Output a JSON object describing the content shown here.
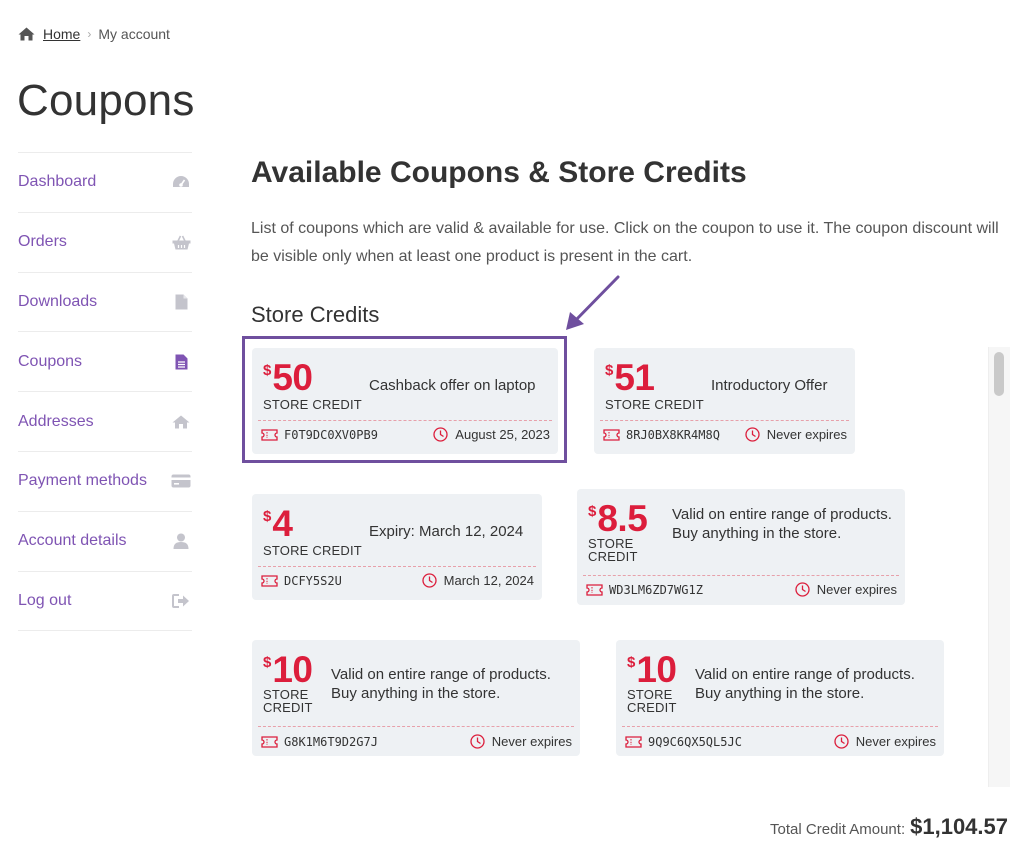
{
  "breadcrumb": {
    "home": "Home",
    "separator": "›",
    "current": "My account"
  },
  "page_title": "Coupons",
  "sidebar": {
    "items": [
      {
        "label": "Dashboard",
        "icon": "dashboard-gauge-icon"
      },
      {
        "label": "Orders",
        "icon": "basket-icon"
      },
      {
        "label": "Downloads",
        "icon": "file-icon"
      },
      {
        "label": "Coupons",
        "icon": "document-icon",
        "active": true
      },
      {
        "label": "Addresses",
        "icon": "home-icon"
      },
      {
        "label": "Payment methods",
        "icon": "credit-card-icon"
      },
      {
        "label": "Account details",
        "icon": "user-icon"
      },
      {
        "label": "Log out",
        "icon": "sign-out-icon"
      }
    ]
  },
  "main": {
    "heading": "Available Coupons & Store Credits",
    "intro": "List of coupons which are valid & available for use. Click on the coupon to use it. The coupon discount will be visible only when at least one product is present in the cart.",
    "section_title": "Store Credits"
  },
  "coupons": [
    {
      "currency": "$",
      "amount": "50",
      "type": "STORE CREDIT",
      "description": "Cashback offer on laptop",
      "code": "F0T9DC0XV0PB9",
      "expiry": "August 25, 2023"
    },
    {
      "currency": "$",
      "amount": "51",
      "type": "STORE CREDIT",
      "description": "Introductory Offer",
      "code": "8RJ0BX8KR4M8Q",
      "expiry": "Never expires"
    },
    {
      "currency": "$",
      "amount": "4",
      "type": "STORE CREDIT",
      "description": "Expiry: March 12, 2024",
      "code": "DCFY5S2U",
      "expiry": "March 12, 2024"
    },
    {
      "currency": "$",
      "amount": "8.5",
      "type_line1": "STORE",
      "type_line2": "CREDIT",
      "description": "Valid on entire range of products. Buy anything in the store.",
      "code": "WD3LM6ZD7WG1Z",
      "expiry": "Never expires"
    },
    {
      "currency": "$",
      "amount": "10",
      "type_line1": "STORE",
      "type_line2": "CREDIT",
      "description": "Valid on entire range of products. Buy anything in the store.",
      "code": "G8K1M6T9D2G7J",
      "expiry": "Never expires"
    },
    {
      "currency": "$",
      "amount": "10",
      "type_line1": "STORE",
      "type_line2": "CREDIT",
      "description": "Valid on entire range of products. Buy anything in the store.",
      "code": "9Q9C6QX5QL5JC",
      "expiry": "Never expires"
    }
  ],
  "total": {
    "label": "Total Credit Amount:",
    "value": "$1,104.57"
  },
  "colors": {
    "accent": "#7f54b3",
    "amount": "#dc1e3c",
    "card_bg": "#eef1f4",
    "highlight": "#6f4f9e"
  }
}
